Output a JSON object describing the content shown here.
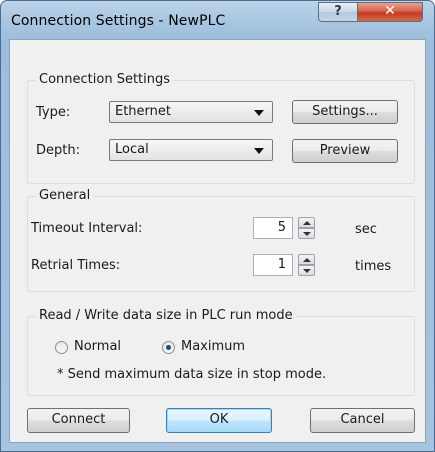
{
  "window": {
    "title": "Connection Settings - NewPLC",
    "help_glyph": "?",
    "close_glyph": "✕"
  },
  "connection_settings": {
    "group_label": "Connection Settings",
    "type_label": "Type:",
    "type_value": "Ethernet",
    "settings_button": "Settings...",
    "depth_label": "Depth:",
    "depth_value": "Local",
    "preview_button": "Preview"
  },
  "general": {
    "group_label": "General",
    "timeout_label": "Timeout Interval:",
    "timeout_value": "5",
    "timeout_unit": "sec",
    "retrial_label": "Retrial Times:",
    "retrial_value": "1",
    "retrial_unit": "times"
  },
  "read_write": {
    "group_label": "Read / Write data size in PLC run mode",
    "option_normal": "Normal",
    "option_maximum": "Maximum",
    "selected": "Maximum",
    "note": "* Send maximum data size in stop mode."
  },
  "buttons": {
    "connect": "Connect",
    "ok": "OK",
    "cancel": "Cancel"
  },
  "colors": {
    "title_gradient": "#a9c6e2",
    "close_button": "#c33a20",
    "client_background": "#f0f0f0",
    "default_button_border": "#3c7fb1"
  }
}
